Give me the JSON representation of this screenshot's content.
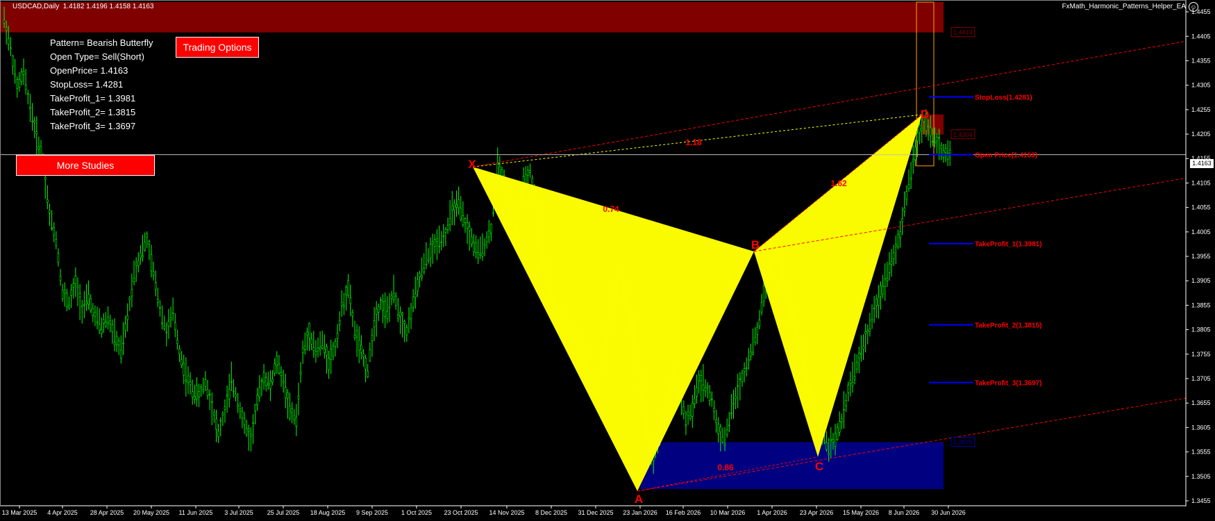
{
  "header": {
    "symbol": "USDCAD,Daily",
    "ohlc": "1.4182 1.4196 1.4158 1.4163",
    "ea_name": "FxMath_Harmonic_Patterns_Helper_EA"
  },
  "info": {
    "pattern": "Pattern= Bearish Butterfly",
    "open_type": "Open Type= Sell(Short)",
    "open_price": "OpenPrice= 1.4163",
    "stop_loss": "StopLoss= 1.4281",
    "tp1": "TakeProfit_1= 1.3981",
    "tp2": "TakeProfit_2= 1.3815",
    "tp3": "TakeProfit_3= 1.3697"
  },
  "buttons": {
    "trading_options": "Trading Options",
    "more_studies": "More Studies"
  },
  "current_price": "1.4163",
  "colors": {
    "candle": "#00ff00",
    "pattern_fill": "#ffff00",
    "point_label": "#ff0000",
    "level_line": "#0000ff",
    "level_text": "#ff0000",
    "top_zone": "#800000",
    "bottom_zone": "#000080"
  },
  "chart_data": {
    "type": "candlestick",
    "ylim": [
      1.3445,
      1.4475
    ],
    "y_ticks": [
      "1.4455",
      "1.4405",
      "1.4355",
      "1.4305",
      "1.4255",
      "1.4205",
      "1.4155",
      "1.4105",
      "1.4055",
      "1.4005",
      "1.3955",
      "1.3905",
      "1.3855",
      "1.3805",
      "1.3755",
      "1.3705",
      "1.3655",
      "1.3605",
      "1.3555",
      "1.3505",
      "1.3455"
    ],
    "x_ticks": [
      "13 Mar 2025",
      "4 Apr 2025",
      "28 Apr 2025",
      "20 May 2025",
      "11 Jun 2025",
      "3 Jul 2025",
      "25 Jul 2025",
      "18 Aug 2025",
      "9 Sep 2025",
      "1 Oct 2025",
      "23 Oct 2025",
      "14 Nov 2025",
      "8 Dec 2025",
      "31 Dec 2025",
      "23 Jan 2026",
      "16 Feb 2026",
      "10 Mar 2026",
      "1 Apr 2026",
      "23 Apr 2026",
      "15 May 2026",
      "8 Jun 2026",
      "30 Jun 2026"
    ],
    "pattern_points": [
      {
        "label": "X",
        "price": 1.4138
      },
      {
        "label": "A",
        "price": 1.3475
      },
      {
        "label": "B",
        "price": 1.3965
      },
      {
        "label": "C",
        "price": 1.3545
      },
      {
        "label": "D",
        "price": 1.4245
      }
    ],
    "ratios": [
      {
        "text": "0.74"
      },
      {
        "text": "0.86"
      },
      {
        "text": "1.62"
      },
      {
        "text": "1.18"
      }
    ],
    "levels": [
      {
        "label": "StopLoss(1.4281)",
        "price": 1.4281
      },
      {
        "label": "Open Price(1.4163)",
        "price": 1.4163
      },
      {
        "label": "TakeProfit_1(1.3981)",
        "price": 1.3981
      },
      {
        "label": "TakeProfit_2(1.3815)",
        "price": 1.3815
      },
      {
        "label": "TakeProfit_3(1.3697)",
        "price": 1.3697
      }
    ],
    "zone_labels": [
      "1.4413",
      "1.4204",
      "1.3575"
    ],
    "close_series": [
      1.444,
      1.438,
      1.43,
      1.433,
      1.426,
      1.42,
      1.415,
      1.404,
      1.399,
      1.388,
      1.386,
      1.39,
      1.385,
      1.387,
      1.383,
      1.381,
      1.383,
      1.379,
      1.376,
      1.383,
      1.392,
      1.396,
      1.399,
      1.392,
      1.385,
      1.38,
      1.384,
      1.376,
      1.371,
      1.368,
      1.367,
      1.37,
      1.365,
      1.359,
      1.364,
      1.37,
      1.366,
      1.361,
      1.358,
      1.366,
      1.371,
      1.369,
      1.374,
      1.37,
      1.364,
      1.362,
      1.376,
      1.38,
      1.376,
      1.378,
      1.374,
      1.377,
      1.385,
      1.389,
      1.38,
      1.376,
      1.372,
      1.382,
      1.386,
      1.384,
      1.388,
      1.383,
      1.38,
      1.386,
      1.391,
      1.395,
      1.397,
      1.399,
      1.4,
      1.405,
      1.406,
      1.402,
      1.399,
      1.396,
      1.398,
      1.401,
      1.414,
      1.411,
      1.406,
      1.402,
      1.41,
      1.413,
      1.405,
      1.396,
      1.388,
      1.384,
      1.382,
      1.38,
      1.379,
      1.376,
      1.37,
      1.368,
      1.372,
      1.38,
      1.388,
      1.391,
      1.386,
      1.38,
      1.37,
      1.36,
      1.354,
      1.36,
      1.365,
      1.37,
      1.368,
      1.362,
      1.364,
      1.37,
      1.369,
      1.366,
      1.36,
      1.358,
      1.364,
      1.368,
      1.372,
      1.376,
      1.38,
      1.388,
      1.394,
      1.396,
      1.39,
      1.385,
      1.38,
      1.374,
      1.368,
      1.364,
      1.36,
      1.356,
      1.358,
      1.362,
      1.368,
      1.372,
      1.376,
      1.38,
      1.384,
      1.388,
      1.392,
      1.396,
      1.4,
      1.408,
      1.415,
      1.421,
      1.423,
      1.42,
      1.418,
      1.4163
    ]
  }
}
